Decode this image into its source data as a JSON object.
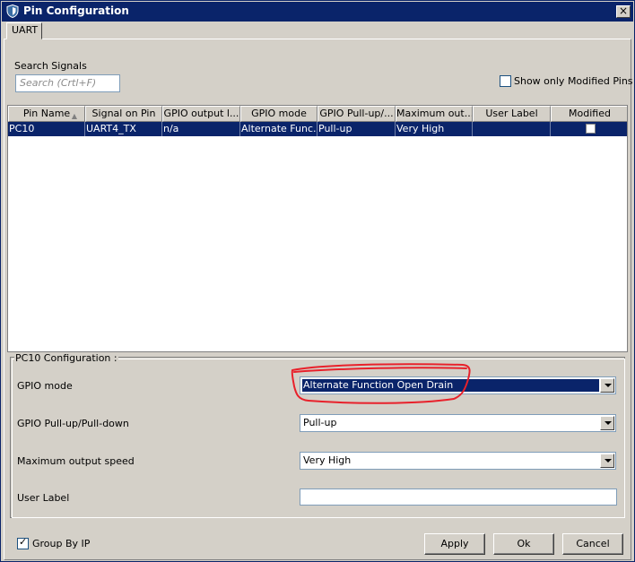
{
  "window": {
    "title": "Pin Configuration",
    "close_glyph": "×",
    "icon": "shield-icon"
  },
  "tabs": [
    {
      "label": "UART",
      "active": true
    }
  ],
  "search": {
    "label": "Search Signals",
    "placeholder": "Search (Crtl+F)"
  },
  "show_modified": {
    "label": "Show only Modified Pins",
    "checked": false
  },
  "table": {
    "columns": [
      {
        "label": "Pin Name",
        "sorted": "ascending"
      },
      {
        "label": "Signal on Pin"
      },
      {
        "label": "GPIO output l..."
      },
      {
        "label": "GPIO mode"
      },
      {
        "label": "GPIO Pull-up/..."
      },
      {
        "label": "Maximum out..."
      },
      {
        "label": "User Label"
      },
      {
        "label": "Modified"
      }
    ],
    "rows": [
      {
        "pin_name": "PC10",
        "signal": "UART4_TX",
        "gpio_output_level": "n/a",
        "gpio_mode": "Alternate Func...",
        "pull": "Pull-up",
        "max_speed": "Very High",
        "user_label": "",
        "modified": false,
        "selected": true
      }
    ]
  },
  "config": {
    "title": "PC10 Configuration :",
    "gpio_mode": {
      "label": "GPIO mode",
      "value": "Alternate Function Open Drain"
    },
    "pull": {
      "label": "GPIO Pull-up/Pull-down",
      "value": "Pull-up"
    },
    "speed": {
      "label": "Maximum output speed",
      "value": "Very High"
    },
    "user_label": {
      "label": "User Label",
      "value": ""
    }
  },
  "annotation_color": "#e8212b",
  "group_by_ip": {
    "label": "Group By IP",
    "checked": true
  },
  "buttons": {
    "apply": "Apply",
    "ok": "Ok",
    "cancel": "Cancel"
  },
  "colors": {
    "titlebar": "#0a246a",
    "selection": "#0a246a",
    "face": "#d4d0c8"
  }
}
